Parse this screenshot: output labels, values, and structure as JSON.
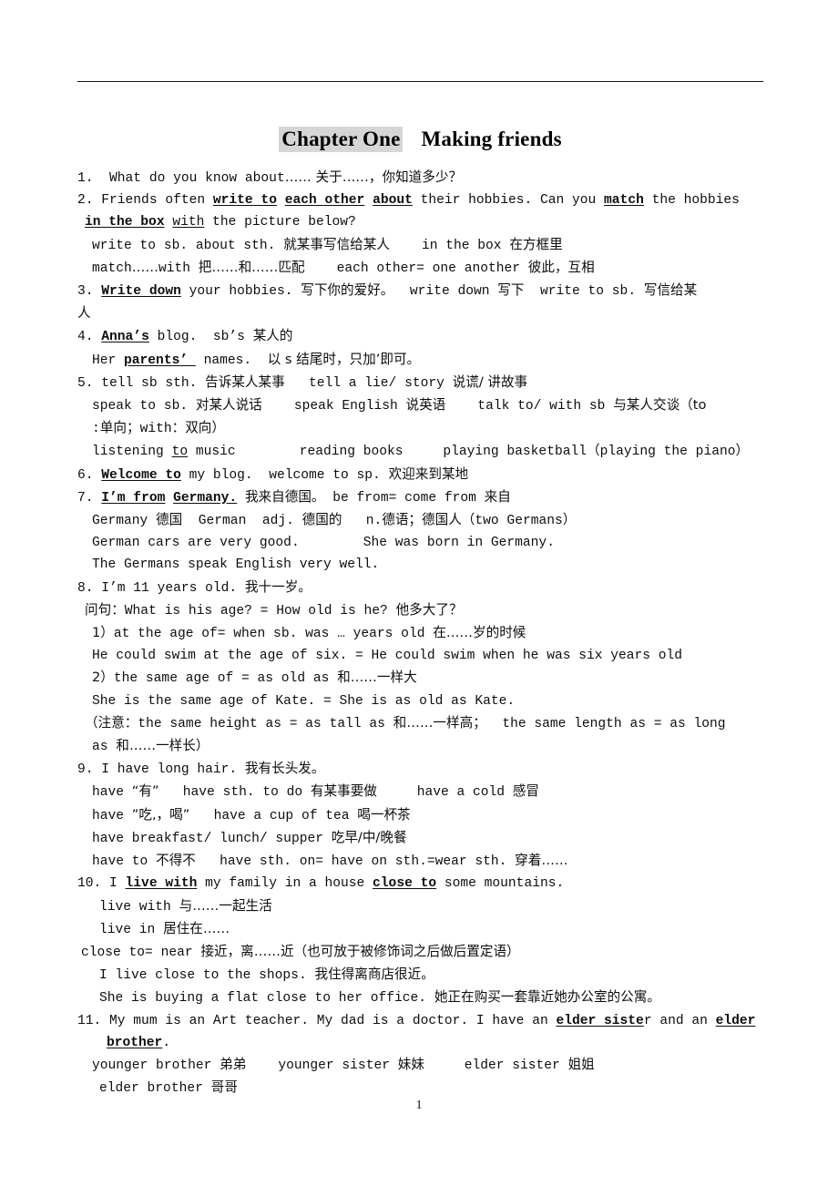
{
  "document": {
    "title_chapter": "Chapter One",
    "title_topic": "Making friends",
    "page_number": "1",
    "highlight_color": "#d6d6d6"
  },
  "lines": [
    {
      "id": "l1",
      "text": "1.  What do you know about…… 关于……，你知道多少？"
    },
    {
      "id": "l2a",
      "text": "2. Friends often write to each other about their hobbies. Can you match the hobbies"
    },
    {
      "id": "l2b",
      "text": "in the box with the picture below?"
    },
    {
      "id": "l2c",
      "text": "write to sb. about sth. 就某事写信给某人    in the box 在方框里"
    },
    {
      "id": "l2d",
      "text": "match……with 把……和……匹配    each other= one another 彼此，互相"
    },
    {
      "id": "l3a",
      "text": "3. Write down your hobbies. 写下你的爱好。  write down 写下  write to sb. 写信给某"
    },
    {
      "id": "l3b",
      "text": "人"
    },
    {
      "id": "l4a",
      "text": "4. Anna’s blog.  sb’s 某人的"
    },
    {
      "id": "l4b",
      "text": "Her parents’ names.  以 s 结尾时，只加’即可。"
    },
    {
      "id": "l5a",
      "text": "5. tell sb sth. 告诉某人某事   tell a lie/ story 说谎/ 讲故事"
    },
    {
      "id": "l5b",
      "text": "speak to sb. 对某人说话    speak English 说英语    talk to/ with sb 与某人交谈（to"
    },
    {
      "id": "l5c",
      "text": ":单向；with：双向）"
    },
    {
      "id": "l5d",
      "text": "listening to music        reading books     playing basketball（playing the piano）"
    },
    {
      "id": "l6",
      "text": "6. Welcome to my blog.  welcome to sp. 欢迎来到某地"
    },
    {
      "id": "l7a",
      "text": "7. I’m from Germany. 我来自德国。 be from= come from 来自"
    },
    {
      "id": "l7b",
      "text": "Germany 德国  German  adj. 德国的   n.德语；德国人（two Germans）"
    },
    {
      "id": "l7c",
      "text": "German cars are very good.        She was born in Germany."
    },
    {
      "id": "l7d",
      "text": "The Germans speak English very well."
    },
    {
      "id": "l8a",
      "text": "8. I’m 11 years old. 我十一岁。"
    },
    {
      "id": "l8b",
      "text": "问句：What is his age? = How old is he? 他多大了？"
    },
    {
      "id": "l8c",
      "text": "1）at the age of= when sb. was … years old 在……岁的时候"
    },
    {
      "id": "l8d",
      "text": "He could swim at the age of six. = He could swim when he was six years old"
    },
    {
      "id": "l8e",
      "text": "2）the same age of = as old as 和……一样大"
    },
    {
      "id": "l8f",
      "text": "She is the same age of Kate. = She is as old as Kate."
    },
    {
      "id": "l8g",
      "text": "（注意：the same height as = as tall as 和……一样高；  the same length as = as long"
    },
    {
      "id": "l8h",
      "text": "as 和……一样长）"
    },
    {
      "id": "l9a",
      "text": "9. I have long hair. 我有长头发。"
    },
    {
      "id": "l9b",
      "text": "have “有”   have sth. to do 有某事要做     have a cold 感冒"
    },
    {
      "id": "l9c",
      "text": "have ”吃,，喝”   have a cup of tea 喝一杯茶"
    },
    {
      "id": "l9d",
      "text": "have breakfast/ lunch/ supper 吃早/中/晚餐"
    },
    {
      "id": "l9e",
      "text": "have to 不得不   have sth. on= have on sth.=wear sth. 穿着……"
    },
    {
      "id": "l10a",
      "text": "10. I live with my family in a house close to some mountains."
    },
    {
      "id": "l10b",
      "text": "live with 与……一起生活"
    },
    {
      "id": "l10c",
      "text": "live in 居住在……"
    },
    {
      "id": "l10d",
      "text": "close to= near 接近，离……近（也可放于被修饰词之后做后置定语）"
    },
    {
      "id": "l10e",
      "text": "I live close to the shops. 我住得离商店很近。"
    },
    {
      "id": "l10f",
      "text": "She is buying a flat close to her office. 她正在购买一套靠近她办公室的公寓。"
    },
    {
      "id": "l11a",
      "text": "11. My mum is an Art teacher. My dad is a doctor. I have an elder sister and an elder"
    },
    {
      "id": "l11b",
      "text": "brother."
    },
    {
      "id": "l11c",
      "text": "younger brother 弟弟    younger sister 妹妹     elder sister 姐姐"
    },
    {
      "id": "l11d",
      "text": "elder brother 哥哥"
    }
  ],
  "segments": {
    "l1": [
      {
        "t": "1.  What do you know about"
      },
      {
        "t": "…… 关于……，你知道多少？",
        "cjk": true
      }
    ],
    "l2a": [
      {
        "t": "2. Friends often "
      },
      {
        "t": "write to",
        "bu": true
      },
      {
        "t": " "
      },
      {
        "t": "each other",
        "bu": true
      },
      {
        "t": " "
      },
      {
        "t": "about",
        "bu": true
      },
      {
        "t": " their hobbies. Can you "
      },
      {
        "t": "match",
        "bu": true
      },
      {
        "t": " the hobbies"
      }
    ],
    "l2b": [
      {
        "t": "in the box",
        "bu": true
      },
      {
        "t": " "
      },
      {
        "t": "with",
        "u": true
      },
      {
        "t": " the picture below?"
      }
    ],
    "l2c": [
      {
        "t": "write to sb. about sth. "
      },
      {
        "t": "就某事写信给某人",
        "cjk": true
      },
      {
        "t": "    in the box "
      },
      {
        "t": "在方框里",
        "cjk": true
      }
    ],
    "l2d": [
      {
        "t": "match"
      },
      {
        "t": "……",
        "cjk": true
      },
      {
        "t": "with "
      },
      {
        "t": "把……和……匹配",
        "cjk": true
      },
      {
        "t": "    each other= one another "
      },
      {
        "t": "彼此，互相",
        "cjk": true
      }
    ],
    "l3a": [
      {
        "t": "3. "
      },
      {
        "t": "Write down",
        "bu": true
      },
      {
        "t": " your hobbies. "
      },
      {
        "t": "写下你的爱好。",
        "cjk": true
      },
      {
        "t": "  write down "
      },
      {
        "t": "写下",
        "cjk": true
      },
      {
        "t": "  write to sb. "
      },
      {
        "t": "写信给某",
        "cjk": true
      }
    ],
    "l3b": [
      {
        "t": "人",
        "cjk": true
      }
    ],
    "l4a": [
      {
        "t": "4. "
      },
      {
        "t": "Anna’s",
        "bu": true
      },
      {
        "t": " blog.  sb’s "
      },
      {
        "t": "某人的",
        "cjk": true
      }
    ],
    "l4b": [
      {
        "t": "Her "
      },
      {
        "t": "parents’ ",
        "bu": true
      },
      {
        "t": " names.  "
      },
      {
        "t": "以 s 结尾时，只加’即可。",
        "cjk": true
      }
    ],
    "l5a": [
      {
        "t": "5. tell sb sth. "
      },
      {
        "t": "告诉某人某事",
        "cjk": true
      },
      {
        "t": "   tell a lie/ story "
      },
      {
        "t": "说谎/ 讲故事",
        "cjk": true
      }
    ],
    "l5b": [
      {
        "t": "speak to sb. "
      },
      {
        "t": "对某人说话",
        "cjk": true
      },
      {
        "t": "    speak English "
      },
      {
        "t": "说英语",
        "cjk": true
      },
      {
        "t": "    talk to/ with sb "
      },
      {
        "t": "与某人交谈（to",
        "cjk": true
      }
    ],
    "l5c": [
      {
        "t": ":"
      },
      {
        "t": "单向；",
        "cjk": true
      },
      {
        "t": "with"
      },
      {
        "t": "：双向）",
        "cjk": true
      }
    ],
    "l5d": [
      {
        "t": "listening "
      },
      {
        "t": "to",
        "u": true
      },
      {
        "t": " music        reading books     playing basketball"
      },
      {
        "t": "（",
        "cjk": true
      },
      {
        "t": "playing the piano"
      },
      {
        "t": "）",
        "cjk": true
      }
    ],
    "l6": [
      {
        "t": "6. "
      },
      {
        "t": "Welcome to",
        "bu": true
      },
      {
        "t": " my blog.  welcome to sp. "
      },
      {
        "t": "欢迎来到某地",
        "cjk": true
      }
    ],
    "l7a": [
      {
        "t": "7. "
      },
      {
        "t": "I’m from",
        "bu": true
      },
      {
        "t": " "
      },
      {
        "t": "Germany.",
        "bu": true
      },
      {
        "t": " "
      },
      {
        "t": "我来自德国。",
        "cjk": true
      },
      {
        "t": " be from= come from "
      },
      {
        "t": "来自",
        "cjk": true
      }
    ],
    "l7b": [
      {
        "t": "Germany "
      },
      {
        "t": "德国",
        "cjk": true
      },
      {
        "t": "  German  adj. "
      },
      {
        "t": "德国的",
        "cjk": true
      },
      {
        "t": "   n."
      },
      {
        "t": "德语；德国人（",
        "cjk": true
      },
      {
        "t": "two Germans"
      },
      {
        "t": "）",
        "cjk": true
      }
    ],
    "l7c": [
      {
        "t": "German cars are very good.        She was born in Germany."
      }
    ],
    "l7d": [
      {
        "t": "The Germans speak English very well."
      }
    ],
    "l8a": [
      {
        "t": "8. I’m 11 years old. "
      },
      {
        "t": "我十一岁。",
        "cjk": true
      }
    ],
    "l8b": [
      {
        "t": "问句：",
        "cjk": true
      },
      {
        "t": "What is his age? = How old is he? "
      },
      {
        "t": "他多大了？",
        "cjk": true
      }
    ],
    "l8c": [
      {
        "t": "1",
        "cjk": true
      },
      {
        "t": "）",
        "cjk": true
      },
      {
        "t": "at the age of= when sb. was … years old "
      },
      {
        "t": "在……岁的时候",
        "cjk": true
      }
    ],
    "l8d": [
      {
        "t": "He could swim at the age of six. = He could swim when he was six years old"
      }
    ],
    "l8e": [
      {
        "t": "2）",
        "cjk": true
      },
      {
        "t": "the same age of = as old as "
      },
      {
        "t": "和……一样大",
        "cjk": true
      }
    ],
    "l8f": [
      {
        "t": "She is the same age of Kate. = She is as old as Kate."
      }
    ],
    "l8g": [
      {
        "t": "（注意：",
        "cjk": true
      },
      {
        "t": "the same height as = as tall as "
      },
      {
        "t": "和……一样高；",
        "cjk": true
      },
      {
        "t": "  the same length as = as long"
      }
    ],
    "l8h": [
      {
        "t": "as "
      },
      {
        "t": "和……一样长）",
        "cjk": true
      }
    ],
    "l9a": [
      {
        "t": "9. I have long hair. "
      },
      {
        "t": "我有长头发。",
        "cjk": true
      }
    ],
    "l9b": [
      {
        "t": "have "
      },
      {
        "t": "“有”",
        "cjk": true
      },
      {
        "t": "   have sth. to do "
      },
      {
        "t": "有某事要做",
        "cjk": true
      },
      {
        "t": "     have a cold "
      },
      {
        "t": "感冒",
        "cjk": true
      }
    ],
    "l9c": [
      {
        "t": "have "
      },
      {
        "t": "”吃,，喝”",
        "cjk": true
      },
      {
        "t": "   have a cup of tea "
      },
      {
        "t": "喝一杯茶",
        "cjk": true
      }
    ],
    "l9d": [
      {
        "t": "have breakfast/ lunch/ supper "
      },
      {
        "t": "吃早/中/晚餐",
        "cjk": true
      }
    ],
    "l9e": [
      {
        "t": "have to "
      },
      {
        "t": "不得不",
        "cjk": true
      },
      {
        "t": "   have sth. on= have on sth.=wear sth. "
      },
      {
        "t": "穿着……",
        "cjk": true
      }
    ],
    "l10a": [
      {
        "t": "10. I "
      },
      {
        "t": "live with",
        "bu": true
      },
      {
        "t": " my family in a house "
      },
      {
        "t": "close to",
        "bu": true
      },
      {
        "t": " some mountains."
      }
    ],
    "l10b": [
      {
        "t": "live with "
      },
      {
        "t": "与……一起生活",
        "cjk": true
      }
    ],
    "l10c": [
      {
        "t": "live in "
      },
      {
        "t": "居住在……",
        "cjk": true
      }
    ],
    "l10d": [
      {
        "t": "close to= near "
      },
      {
        "t": "接近，离……近（也可放于被修饰词之后做后置定语）",
        "cjk": true
      }
    ],
    "l10e": [
      {
        "t": "I live close to the shops. "
      },
      {
        "t": "我住得离商店很近。",
        "cjk": true
      }
    ],
    "l10f": [
      {
        "t": "She is buying a flat close to her office. "
      },
      {
        "t": "她正在购买一套靠近她办公室的公寓。",
        "cjk": true
      }
    ],
    "l11a": [
      {
        "t": "11. My mum is an Art teacher. My dad is a doctor. I have an "
      },
      {
        "t": "elder siste",
        "bu": true
      },
      {
        "t": "r and an "
      },
      {
        "t": "elder",
        "bu": true
      }
    ],
    "l11b": [
      {
        "t": "brother",
        "bu": true
      },
      {
        "t": "."
      }
    ],
    "l11c": [
      {
        "t": "younger brother "
      },
      {
        "t": "弟弟",
        "cjk": true
      },
      {
        "t": "    younger sister "
      },
      {
        "t": "妹妹",
        "cjk": true
      },
      {
        "t": "     elder sister "
      },
      {
        "t": "姐姐",
        "cjk": true
      }
    ],
    "l11d": [
      {
        "t": "elder brother "
      },
      {
        "t": "哥哥",
        "cjk": true
      }
    ]
  },
  "line_order": [
    {
      "id": "l1",
      "cls": "i0"
    },
    {
      "id": "l2a",
      "cls": "i0"
    },
    {
      "id": "l2b",
      "cls": "i1"
    },
    {
      "id": "l2c",
      "cls": "i2"
    },
    {
      "id": "l2d",
      "cls": "i2"
    },
    {
      "id": "l3a",
      "cls": "i0"
    },
    {
      "id": "l3b",
      "cls": "i0"
    },
    {
      "id": "l4a",
      "cls": "i0"
    },
    {
      "id": "l4b",
      "cls": "i2"
    },
    {
      "id": "l5a",
      "cls": "i0"
    },
    {
      "id": "l5b",
      "cls": "i2"
    },
    {
      "id": "l5c",
      "cls": "i2"
    },
    {
      "id": "l5d",
      "cls": "i2"
    },
    {
      "id": "l6",
      "cls": "i0"
    },
    {
      "id": "l7a",
      "cls": "i0"
    },
    {
      "id": "l7b",
      "cls": "i2"
    },
    {
      "id": "l7c",
      "cls": "i2"
    },
    {
      "id": "l7d",
      "cls": "i2"
    },
    {
      "id": "l8a",
      "cls": "i0"
    },
    {
      "id": "l8b",
      "cls": "i1"
    },
    {
      "id": "l8c",
      "cls": "i2"
    },
    {
      "id": "l8d",
      "cls": "i2"
    },
    {
      "id": "l8e",
      "cls": "i2"
    },
    {
      "id": "l8f",
      "cls": "i2"
    },
    {
      "id": "l8g",
      "cls": "i1"
    },
    {
      "id": "l8h",
      "cls": "i2"
    },
    {
      "id": "l9a",
      "cls": "i0"
    },
    {
      "id": "l9b",
      "cls": "i2"
    },
    {
      "id": "l9c",
      "cls": "i2"
    },
    {
      "id": "l9d",
      "cls": "i2"
    },
    {
      "id": "l9e",
      "cls": "i2"
    },
    {
      "id": "l10a",
      "cls": "i0"
    },
    {
      "id": "l10b",
      "cls": "i3"
    },
    {
      "id": "l10c",
      "cls": "i3"
    },
    {
      "id": "l10d",
      "cls": "i-h"
    },
    {
      "id": "l10e",
      "cls": "i3"
    },
    {
      "id": "l10f",
      "cls": "i3"
    },
    {
      "id": "l11a",
      "cls": "i0"
    },
    {
      "id": "l11b",
      "cls": "i4"
    },
    {
      "id": "l11c",
      "cls": "i2"
    },
    {
      "id": "l11d",
      "cls": "i3"
    }
  ]
}
